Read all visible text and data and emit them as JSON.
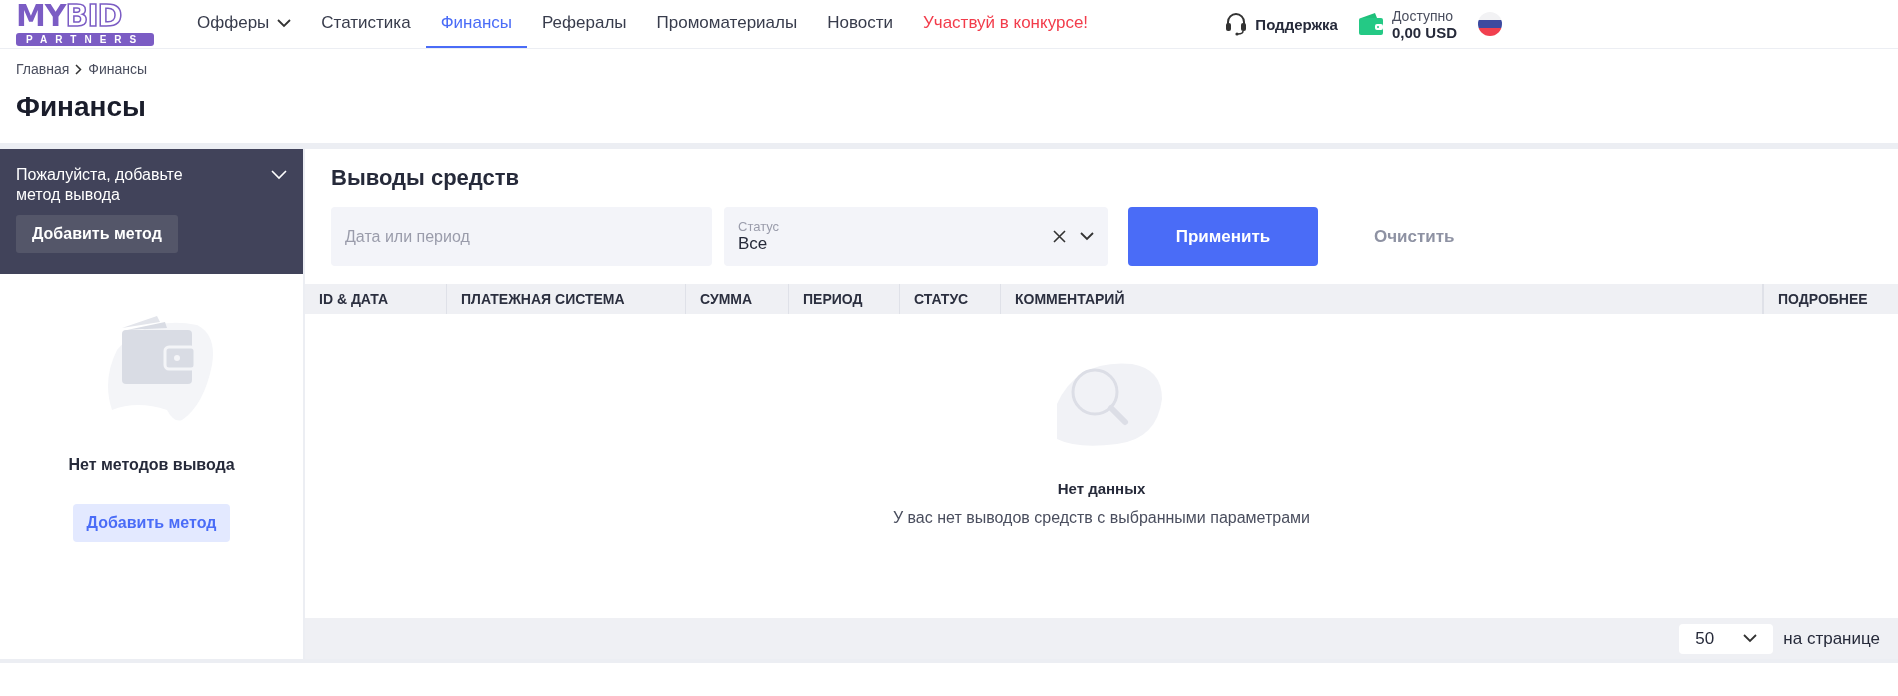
{
  "logo": {
    "word_a": "MY",
    "word_b": "BID",
    "subtitle": "PARTNERS"
  },
  "nav": [
    {
      "label": "Офферы",
      "selected": false,
      "dropdown": true,
      "kind": "normal"
    },
    {
      "label": "Статистика",
      "selected": false,
      "dropdown": false,
      "kind": "normal"
    },
    {
      "label": "Финансы",
      "selected": true,
      "dropdown": false,
      "kind": "normal"
    },
    {
      "label": "Рефералы",
      "selected": false,
      "dropdown": false,
      "kind": "normal"
    },
    {
      "label": "Промоматериалы",
      "selected": false,
      "dropdown": false,
      "kind": "normal"
    },
    {
      "label": "Новости",
      "selected": false,
      "dropdown": false,
      "kind": "normal"
    },
    {
      "label": "Участвуй в конкурсе!",
      "selected": false,
      "dropdown": false,
      "kind": "promo"
    }
  ],
  "support": "Поддержка",
  "balance": {
    "label": "Доступно",
    "amount": "0,00 USD"
  },
  "breadcrumbs": [
    "Главная",
    "Финансы"
  ],
  "page_title": "Финансы",
  "methods_panel": {
    "notice": "Пожалуйста, добавьте метод вывода",
    "expanded": false,
    "notice_button": "Добавить метод",
    "empty_title": "Нет методов вывода",
    "empty_button": "Добавить метод"
  },
  "withdrawals": {
    "title": "Выводы средств",
    "date_field": {
      "placeholder": "Дата или период"
    },
    "status_field": {
      "label": "Статус",
      "value": "Все"
    },
    "apply_button": "Применить",
    "clear_button": "Очистить",
    "table": {
      "columns": [
        "ID & ДАТА",
        "ПЛАТЕЖНАЯ СИСТЕМА",
        "СУММА",
        "ПЕРИОД",
        "СТАТУС",
        "КОММЕНТАРИЙ",
        "ПОДРОБНЕЕ"
      ]
    },
    "empty_title": "Нет данных",
    "empty_text": "У вас нет выводов средств с выбранными параметрами",
    "page_size": "50",
    "page_size_label": "на странице"
  }
}
